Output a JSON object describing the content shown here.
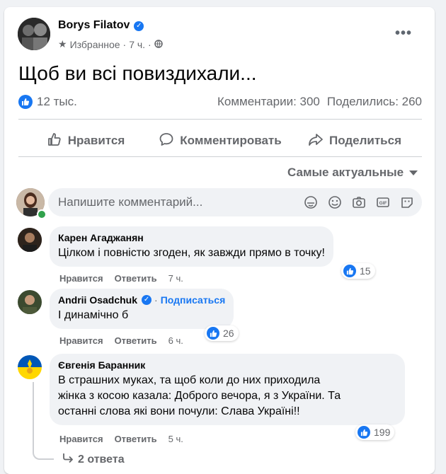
{
  "post": {
    "author": "Borys Filatov",
    "meta_label": "Избранное",
    "time": "7 ч.",
    "text": "Щоб ви всі повиздихали...",
    "likes": "12 тыс.",
    "comments": "Комментарии: 300",
    "shares": "Поделились: 260"
  },
  "actions": {
    "like": "Нравится",
    "comment": "Комментировать",
    "share": "Поделиться"
  },
  "sort_label": "Самые актуальные",
  "composer": {
    "placeholder": "Напишите комментарий..."
  },
  "comments": [
    {
      "author": "Карен Агаджанян",
      "text": "Цілком і повністю згоден, як завжди прямо в точку!",
      "like": "Нравится",
      "reply": "Ответить",
      "time": "7 ч.",
      "reactions": "15"
    },
    {
      "author": "Andrii Osadchuk",
      "subscribe": "Подписаться",
      "text": "І динамічно б",
      "like": "Нравится",
      "reply": "Ответить",
      "time": "6 ч.",
      "reactions": "26"
    },
    {
      "author": "Євгенія Баранник",
      "text_lines": [
        "В страшних муках, та щоб коли до них приходила",
        "жінка з косою казала: Доброго вечора, я з України. Та",
        "останні слова які вони почули: Слава Україні!!"
      ],
      "like": "Нравится",
      "reply": "Ответить",
      "time": "5 ч.",
      "reactions": "199"
    }
  ],
  "replies_label": "2 ответа",
  "colors": {
    "accent": "#1877f2",
    "muted": "#65676b",
    "bubble": "#f0f2f5"
  }
}
